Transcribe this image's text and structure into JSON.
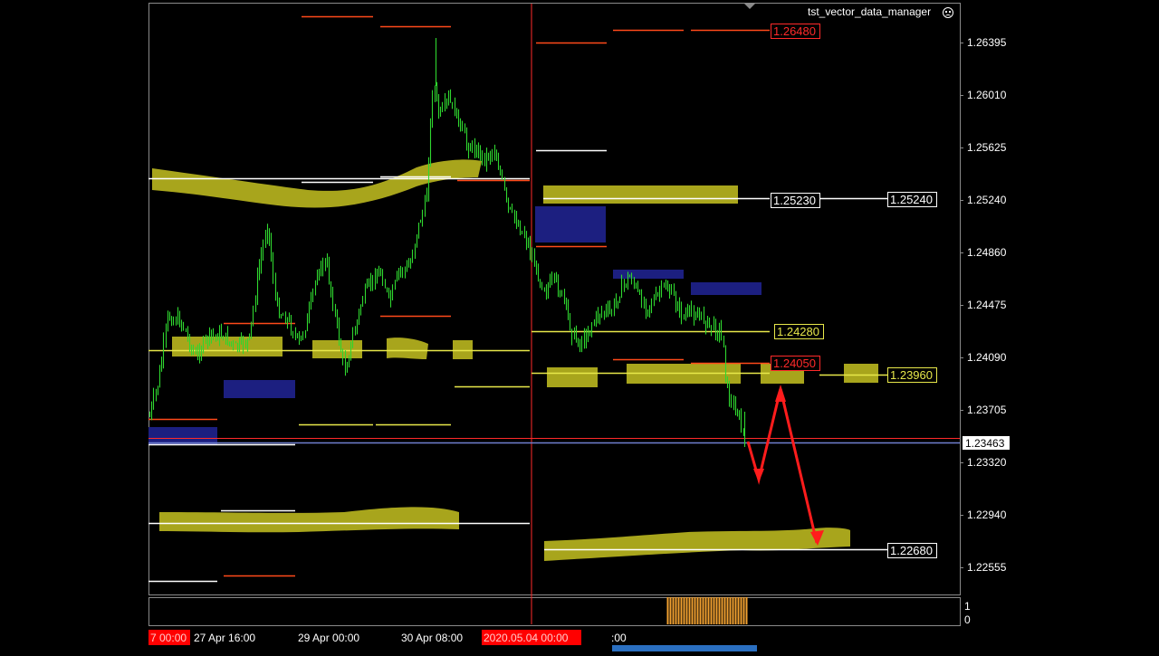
{
  "indicator_title": "tst_vector_data_manager",
  "indicator_status_icon": "sad-face-icon",
  "colors": {
    "background": "#000000",
    "foreground": "#ffffff",
    "candle": "#2fd62f",
    "zone_yellow": "#a8a51c",
    "zone_blue": "#1c1f80",
    "resistance_line": "#ff4a1a",
    "level_white": "#ffffff",
    "level_yellow": "#e8e84a",
    "arrow": "#ff1c1c",
    "price_line": "#ff2a2a",
    "volume": "#f0a030",
    "time_highlight": "#ff0000"
  },
  "price_scale": [
    "1.26395",
    "1.26010",
    "1.25625",
    "1.25240",
    "1.24860",
    "1.24475",
    "1.24090",
    "1.23705",
    "1.23320",
    "1.22940",
    "1.22555"
  ],
  "current_price": "1.23463",
  "level_labels": [
    {
      "text": "1.26480",
      "style": "red"
    },
    {
      "text": "1.25230",
      "style": "white"
    },
    {
      "text": "1.25240",
      "style": "white"
    },
    {
      "text": "1.24280",
      "style": "yellow"
    },
    {
      "text": "1.24050",
      "style": "red"
    },
    {
      "text": "1.23960",
      "style": "yellow"
    },
    {
      "text": "1.22680",
      "style": "white"
    }
  ],
  "sub_window_scale": [
    "1",
    "0"
  ],
  "time_axis": [
    {
      "text": "7 00:00",
      "highlight": true
    },
    {
      "text": "27 Apr 16:00",
      "highlight": false
    },
    {
      "text": "29 Apr 00:00",
      "highlight": false
    },
    {
      "text": "30 Apr 08:00",
      "highlight": false
    },
    {
      "text": "2020.05.04 00:00",
      "highlight": true
    },
    {
      "text": ":00",
      "highlight": false
    }
  ]
}
